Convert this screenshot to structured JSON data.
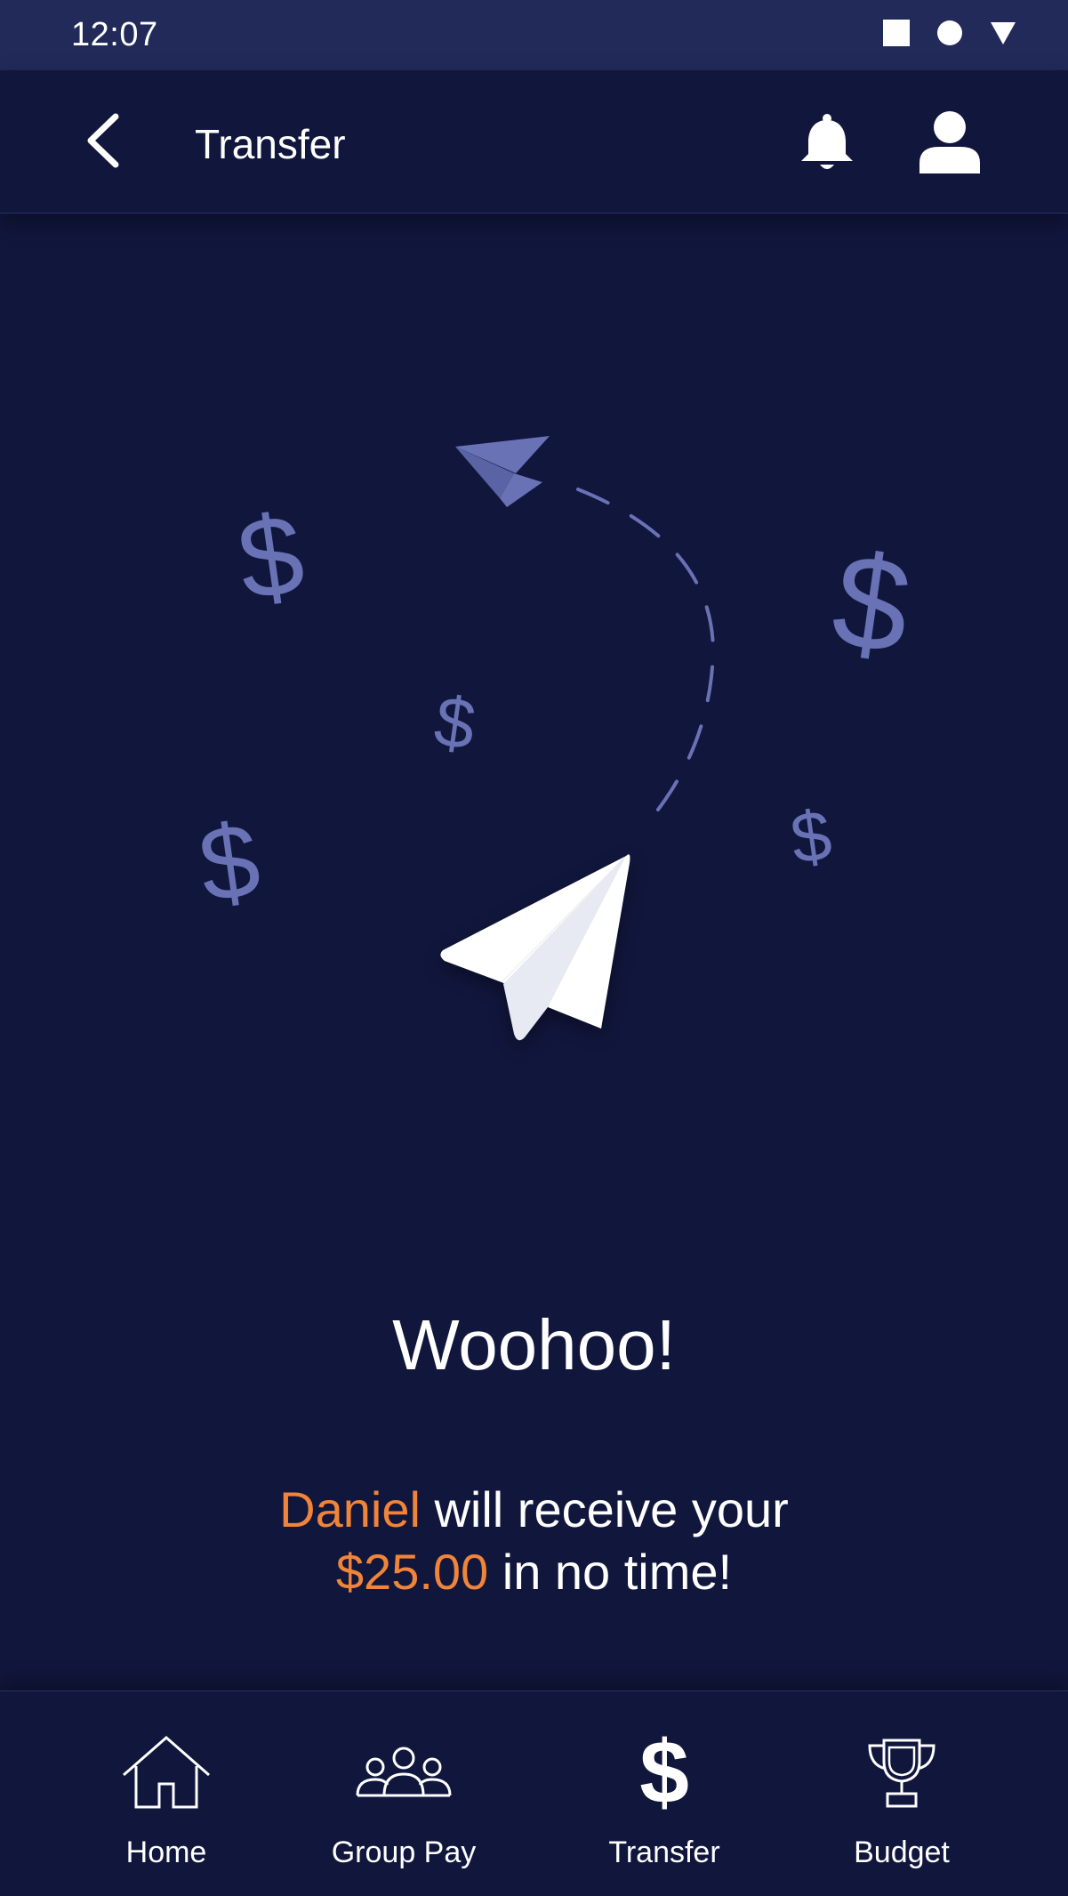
{
  "status_bar": {
    "time": "12:07",
    "icons": [
      "square-icon",
      "circle-icon",
      "triangle-down-icon"
    ]
  },
  "app_bar": {
    "title": "Transfer",
    "icons": [
      "back-arrow-icon",
      "bell-icon",
      "user-icon"
    ]
  },
  "confirmation": {
    "headline": "Woohoo!",
    "recipient": "Daniel",
    "line1_rest": " will receive your",
    "amount": "$25.00",
    "line2_rest": " in no time!"
  },
  "illustration": {
    "dollar_sign": "$",
    "icons": [
      "paper-plane-icon",
      "dollar-icon"
    ]
  },
  "bottom_nav": {
    "items": [
      {
        "label": "Home",
        "icon": "home-icon"
      },
      {
        "label": "Group Pay",
        "icon": "group-icon"
      },
      {
        "label": "Transfer",
        "icon": "dollar-icon",
        "active": true
      },
      {
        "label": "Budget",
        "icon": "trophy-icon"
      }
    ]
  },
  "colors": {
    "background": "#11163c",
    "status_bar": "#222a5a",
    "accent": "#f08439",
    "illustration": "#6872b5",
    "text": "#ffffff"
  }
}
